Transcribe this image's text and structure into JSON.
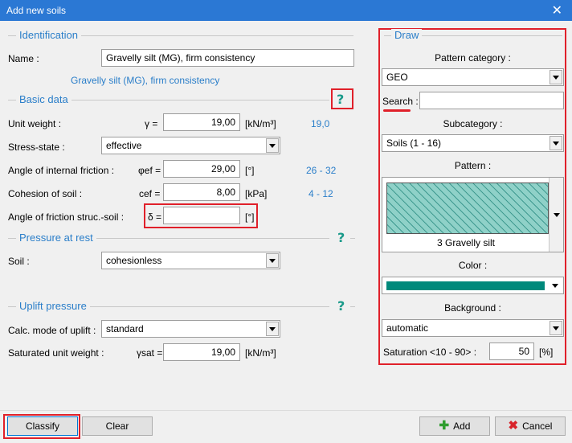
{
  "window": {
    "title": "Add new soils",
    "close_glyph": "✕"
  },
  "identification": {
    "section_title": "Identification",
    "name_label": "Name :",
    "name_value": "Gravelly silt (MG), firm consistency",
    "name_preview": "Gravelly silt (MG), firm consistency"
  },
  "basic_data": {
    "section_title": "Basic data",
    "help": "?",
    "unit_weight": {
      "label": "Unit weight :",
      "symbol": "γ =",
      "value": "19,00",
      "unit": "[kN/m³]",
      "hint": "19,0"
    },
    "stress_state": {
      "label": "Stress-state :",
      "value": "effective"
    },
    "friction_angle": {
      "label": "Angle of internal friction :",
      "symbol": "φef =",
      "value": "29,00",
      "unit": "[°]",
      "hint": "26 - 32"
    },
    "cohesion": {
      "label": "Cohesion of soil :",
      "symbol": "cef =",
      "value": "8,00",
      "unit": "[kPa]",
      "hint": "4 - 12"
    },
    "struc_friction": {
      "label": "Angle of friction struc.-soil :",
      "symbol": "δ =",
      "value": "",
      "unit": "[°]"
    }
  },
  "pressure_at_rest": {
    "section_title": "Pressure at rest",
    "help": "?",
    "soil_label": "Soil :",
    "soil_value": "cohesionless"
  },
  "uplift": {
    "section_title": "Uplift pressure",
    "help": "?",
    "mode_label": "Calc. mode of uplift :",
    "mode_value": "standard",
    "sat_label": "Saturated unit weight :",
    "sat_symbol": "γsat =",
    "sat_value": "19,00",
    "sat_unit": "[kN/m³]"
  },
  "draw": {
    "section_title": "Draw",
    "pattern_category_label": "Pattern category :",
    "pattern_category_value": "GEO",
    "search_label": "Search :",
    "search_value": "",
    "subcategory_label": "Subcategory :",
    "subcategory_value": "Soils (1 - 16)",
    "pattern_label": "Pattern :",
    "pattern_name": "3 Gravelly silt",
    "color_label": "Color :",
    "color_hex": "#00897b",
    "background_label": "Background :",
    "background_value": "automatic",
    "saturation_label": "Saturation <10 - 90> :",
    "saturation_value": "50",
    "saturation_unit": "[%]"
  },
  "buttons": {
    "classify": "Classify",
    "clear": "Clear",
    "add": "Add",
    "add_icon": "plus-icon",
    "cancel": "Cancel",
    "cancel_icon": "x-icon"
  },
  "colors": {
    "title_bar": "#2b78d4",
    "accent": "#2a7ec9",
    "highlight": "#e0202a",
    "help": "#1a9a8a"
  }
}
